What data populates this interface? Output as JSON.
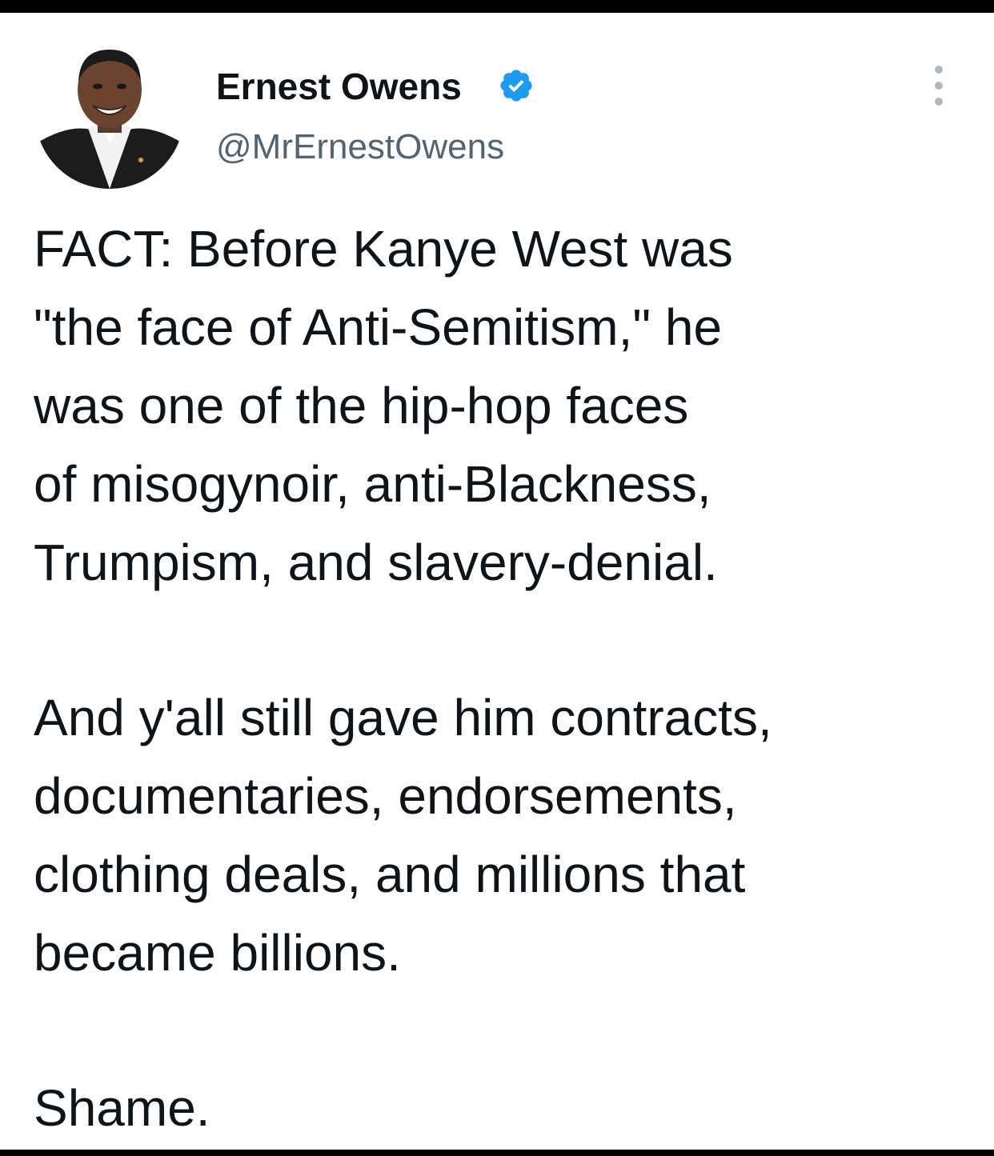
{
  "author": {
    "display_name": "Ernest Owens",
    "handle": "@MrErnestOwens",
    "verified": true,
    "verified_color": "#1d9bf0"
  },
  "icons": {
    "verified": "verified-badge-icon",
    "more": "more-options-icon"
  },
  "tweet": {
    "paragraph_1": "FACT: Before Kanye West was\n\"the face of Anti-Semitism,\" he\nwas one of the hip-hop faces\nof misogynoir, anti-Blackness,\nTrumpism, and slavery-denial.",
    "paragraph_2": "And y'all still gave him contracts,\ndocumentaries, endorsements,\nclothing deals, and millions that\nbecame billions.",
    "paragraph_3": "Shame."
  }
}
